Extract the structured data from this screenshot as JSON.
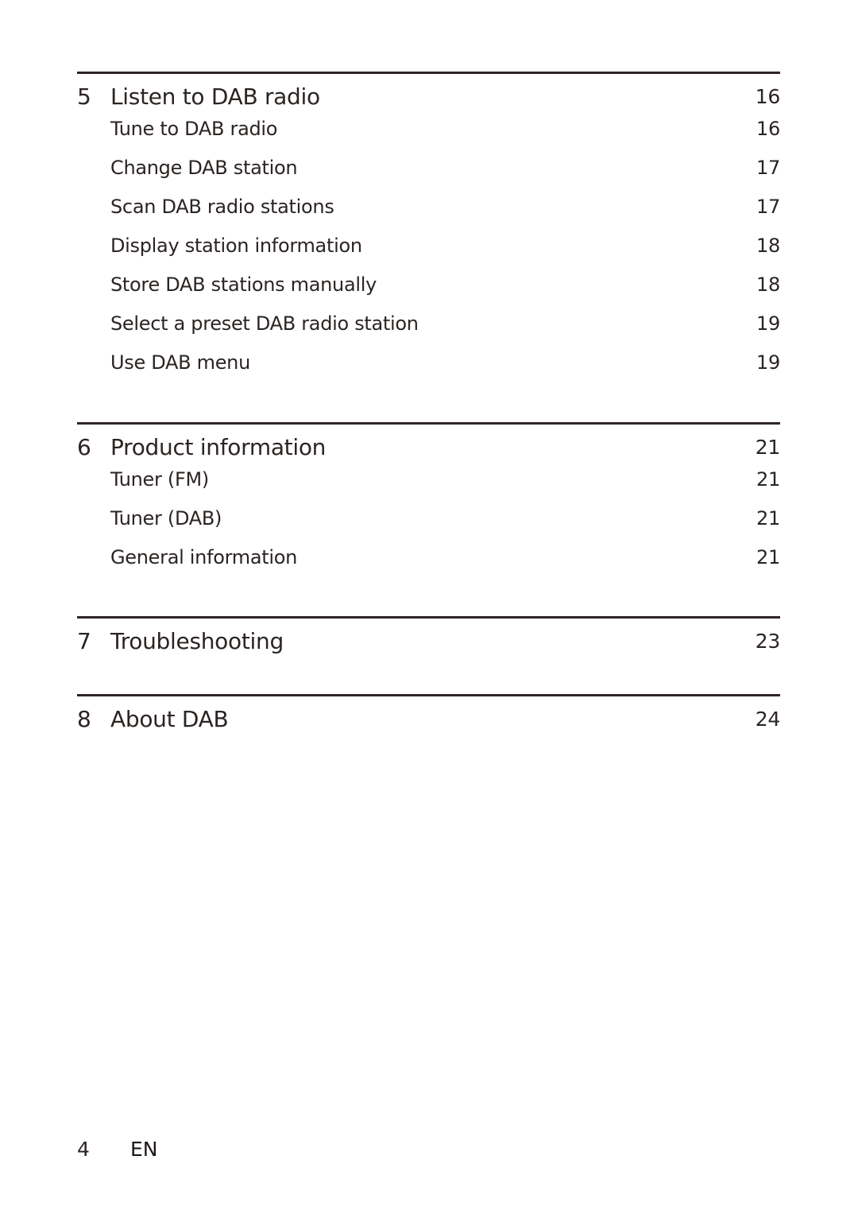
{
  "toc": {
    "sections": [
      {
        "number": "5",
        "title": "Listen to DAB radio",
        "page": "16",
        "items": [
          {
            "title": "Tune to DAB radio",
            "page": "16"
          },
          {
            "title": "Change DAB station",
            "page": "17"
          },
          {
            "title": "Scan DAB radio stations",
            "page": "17"
          },
          {
            "title": "Display station information",
            "page": "18"
          },
          {
            "title": "Store DAB stations manually",
            "page": "18"
          },
          {
            "title": "Select a preset DAB radio station",
            "page": "19"
          },
          {
            "title": "Use DAB menu",
            "page": "19"
          }
        ]
      },
      {
        "number": "6",
        "title": "Product information",
        "page": "21",
        "items": [
          {
            "title": "Tuner (FM)",
            "page": "21"
          },
          {
            "title": "Tuner (DAB)",
            "page": "21"
          },
          {
            "title": "General information",
            "page": "21"
          }
        ]
      },
      {
        "number": "7",
        "title": "Troubleshooting",
        "page": "23",
        "items": []
      },
      {
        "number": "8",
        "title": "About DAB",
        "page": "24",
        "items": []
      }
    ]
  },
  "footer": {
    "page_number": "4",
    "language": "EN"
  },
  "colors": {
    "text": "#2b2422",
    "rule": "#2e2624"
  }
}
